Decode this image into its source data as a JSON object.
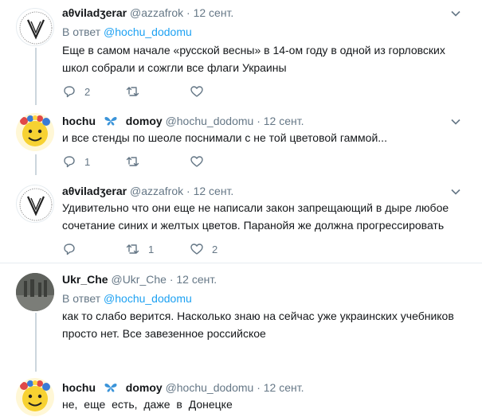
{
  "tweets": [
    {
      "name": "aθviladʒerar",
      "handle": "@azzafrok",
      "dot": "·",
      "time": "12 сент.",
      "reply_prefix": "В ответ",
      "reply_mention": "@hochu_dodomu",
      "text": "Еще в самом начале «русской весны» в 14-ом году в одной из горловских школ собрали и сожгли все флаги Украины",
      "reply_count": "2",
      "retweet_count": "",
      "like_count": ""
    },
    {
      "name_part1": "hochu",
      "name_part2": "domoy",
      "handle": "@hochu_dodomu",
      "dot": "·",
      "time": "12 сент.",
      "text": "и все стенды по шеоле поснимали с не той цветовой гаммой...",
      "reply_count": "1",
      "retweet_count": "",
      "like_count": ""
    },
    {
      "name": "aθviladʒerar",
      "handle": "@azzafrok",
      "dot": "·",
      "time": "12 сент.",
      "text": "Удивительно что они еще не написали закон запрещающий в дыре любое сочетание синих и желтых цветов. Паранойя же должна прогрессировать",
      "reply_count": "",
      "retweet_count": "1",
      "like_count": "2"
    },
    {
      "name": "Ukr_Che",
      "handle": "@Ukr_Che",
      "dot": "·",
      "time": "12 сент.",
      "reply_prefix": "В ответ",
      "reply_mention": "@hochu_dodomu",
      "text": "как то слабо верится. Насколько знаю на сейчас уже украинских учебников просто нет. Все завезенное российское"
    },
    {
      "name_part1": "hochu",
      "name_part2": "domoy",
      "handle": "@hochu_dodomu",
      "dot": "·",
      "time": "12 сент.",
      "text": "не, еще есть, даже в Донецке"
    }
  ],
  "colors": {
    "accent": "#1da1f2",
    "muted": "#657786",
    "thread": "#ccd6dd",
    "divider": "#e6ecf0"
  },
  "icons": {
    "reply": "reply-icon",
    "retweet": "retweet-icon",
    "like": "heart-icon",
    "menu": "chevron-down-icon"
  }
}
